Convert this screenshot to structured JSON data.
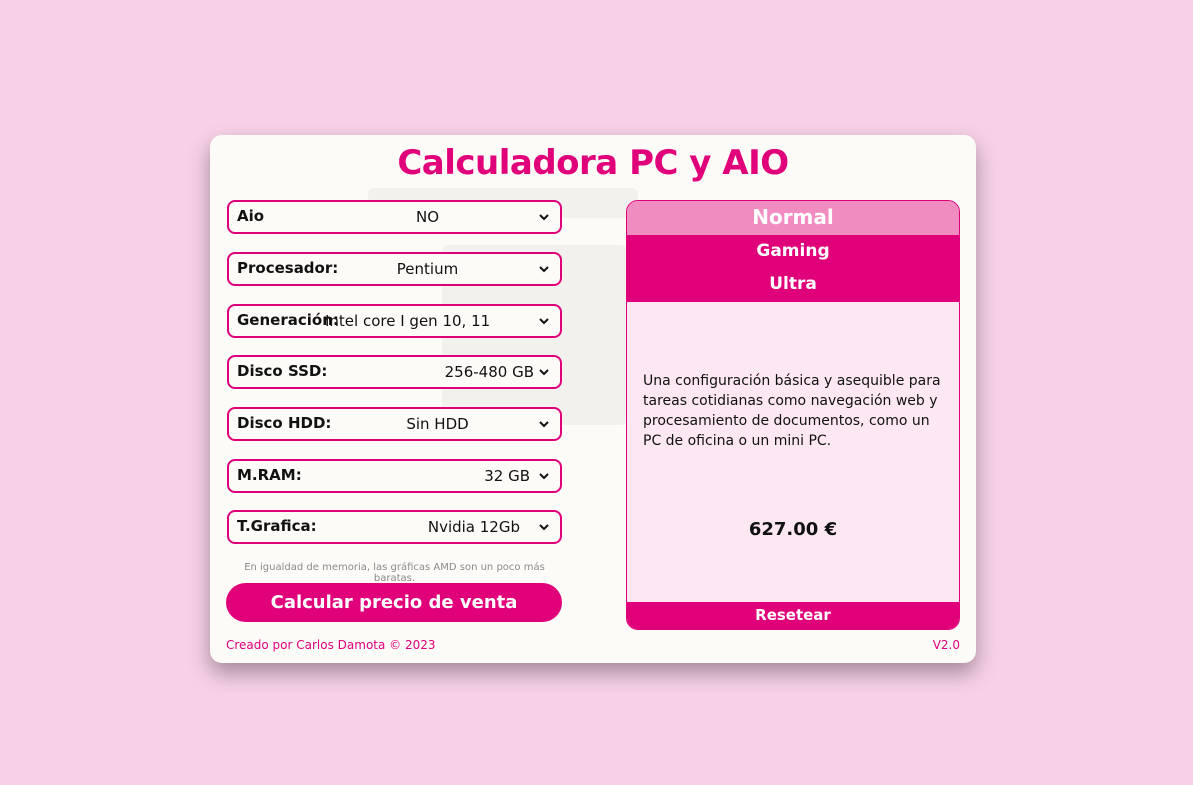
{
  "app": {
    "title": "Calculadora PC y AIO"
  },
  "form": {
    "fields": [
      {
        "label": "Aio",
        "value": "NO"
      },
      {
        "label": "Procesador:",
        "value": "Pentium"
      },
      {
        "label": "Generación:",
        "value": "Intel core I gen 10, 11"
      },
      {
        "label": "Disco SSD:",
        "value": "256-480 GB"
      },
      {
        "label": "Disco HDD:",
        "value": "Sin HDD"
      },
      {
        "label": "M.RAM:",
        "value": "32 GB"
      },
      {
        "label": "T.Grafica:",
        "value": "Nvidia 12Gb"
      }
    ],
    "hint": "En igualdad de memoria, las gráficas AMD son un poco más baratas.",
    "calculate_label": "Calcular precio de venta"
  },
  "result": {
    "tabs": [
      {
        "label": "Normal",
        "selected": true
      },
      {
        "label": "Gaming",
        "selected": false
      },
      {
        "label": "Ultra",
        "selected": false
      }
    ],
    "description": "Una configuración básica y asequible para tareas cotidianas como navegación web y procesamiento de documentos, como un PC de oficina o un mini PC.",
    "price": "627.00 €",
    "reset_label": "Resetear"
  },
  "footer": {
    "credit": "Creado por Carlos Damota © 2023",
    "version": "V2.0"
  },
  "colors": {
    "accent": "#e0007a",
    "accent_light": "#f08cbf",
    "page_bg": "#f8d1e7",
    "card_bg": "#fdfbf8",
    "panel_bg": "#fde7f2"
  },
  "icons": {
    "select_arrow": "chevron-down-icon"
  }
}
